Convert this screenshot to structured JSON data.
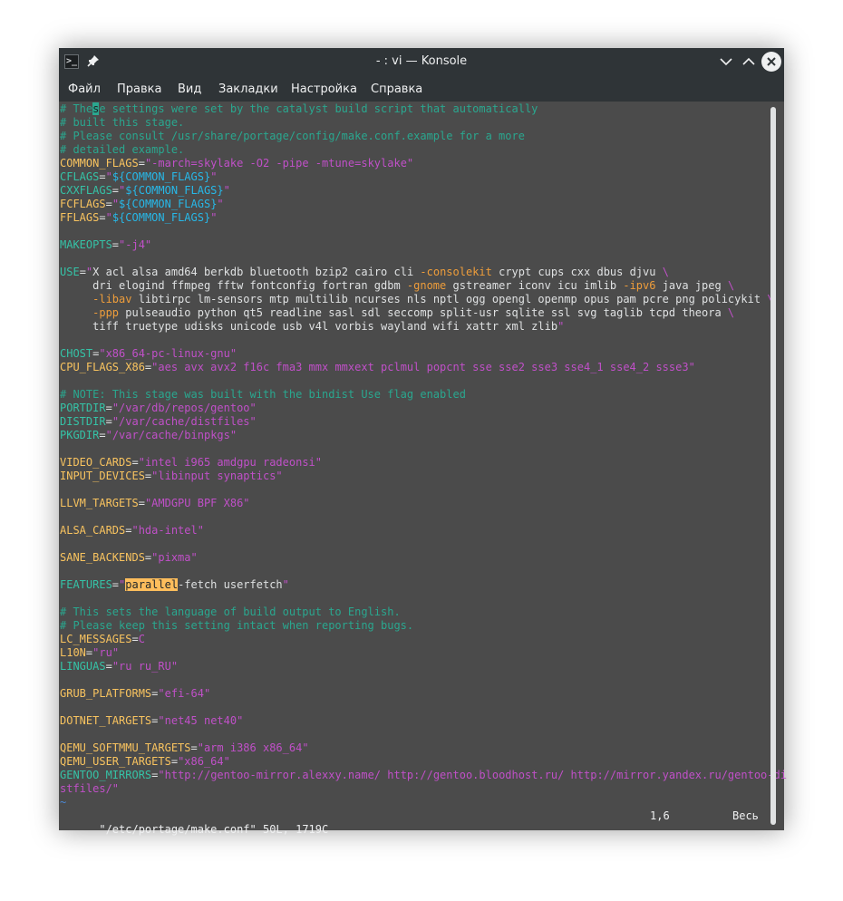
{
  "window": {
    "title": "- : vi — Konsole",
    "app_icon_glyph": ">_"
  },
  "menu": [
    {
      "label": "Файл"
    },
    {
      "label": "Правка"
    },
    {
      "label": "Вид"
    },
    {
      "label": "Закладки"
    },
    {
      "label": "Настройка"
    },
    {
      "label": "Справка"
    }
  ],
  "colors": {
    "titlebar_bg": "#2f3437",
    "terminal_bg": "#4b4b4b",
    "comment": "#2aa78f",
    "variable": "#f8c35f",
    "variable_alt": "#35c2a6",
    "string": "#c050c8",
    "expansion": "#27b8e8",
    "search_highlight": "#fdbd5c"
  },
  "editor": {
    "lines": [
      [
        {
          "t": "# The",
          "c": "comment"
        },
        {
          "t": "s",
          "c": "cursor"
        },
        {
          "t": "e settings were set by the catalyst build script that automatically",
          "c": "comment"
        }
      ],
      [
        {
          "t": "# built this stage.",
          "c": "comment"
        }
      ],
      [
        {
          "t": "# Please consult /usr/share/portage/config/make.conf.example for a more",
          "c": "comment"
        }
      ],
      [
        {
          "t": "# detailed example.",
          "c": "comment"
        }
      ],
      [
        {
          "t": "COMMON_FLAGS",
          "c": "key"
        },
        {
          "t": "=",
          "c": "text"
        },
        {
          "t": "\"-march=skylake -O2 -pipe -mtune=skylake\"",
          "c": "str"
        }
      ],
      [
        {
          "t": "CFLAGS",
          "c": "key2"
        },
        {
          "t": "=",
          "c": "text"
        },
        {
          "t": "\"",
          "c": "str"
        },
        {
          "t": "${COMMON_FLAGS}",
          "c": "var"
        },
        {
          "t": "\"",
          "c": "str"
        }
      ],
      [
        {
          "t": "CXXFLAGS",
          "c": "key2"
        },
        {
          "t": "=",
          "c": "text"
        },
        {
          "t": "\"",
          "c": "str"
        },
        {
          "t": "${COMMON_FLAGS}",
          "c": "var"
        },
        {
          "t": "\"",
          "c": "str"
        }
      ],
      [
        {
          "t": "FCFLAGS",
          "c": "key"
        },
        {
          "t": "=",
          "c": "text"
        },
        {
          "t": "\"",
          "c": "str"
        },
        {
          "t": "${COMMON_FLAGS}",
          "c": "var"
        },
        {
          "t": "\"",
          "c": "str"
        }
      ],
      [
        {
          "t": "FFLAGS",
          "c": "key"
        },
        {
          "t": "=",
          "c": "text"
        },
        {
          "t": "\"",
          "c": "str"
        },
        {
          "t": "${COMMON_FLAGS}",
          "c": "var"
        },
        {
          "t": "\"",
          "c": "str"
        }
      ],
      [],
      [
        {
          "t": "MAKEOPTS",
          "c": "key2"
        },
        {
          "t": "=",
          "c": "text"
        },
        {
          "t": "\"-j4\"",
          "c": "str"
        }
      ],
      [],
      [
        {
          "t": "USE",
          "c": "key2"
        },
        {
          "t": "=",
          "c": "text"
        },
        {
          "t": "\"",
          "c": "str"
        },
        {
          "t": "X acl alsa amd64 berkdb bluetooth bzip2 cairo cli ",
          "c": "text"
        },
        {
          "t": "-consolekit",
          "c": "minus"
        },
        {
          "t": " crypt cups cxx dbus djvu ",
          "c": "text"
        },
        {
          "t": "\\",
          "c": "str"
        }
      ],
      [
        {
          "t": "     dri elogind ffmpeg fftw fontconfig fortran gdbm ",
          "c": "text"
        },
        {
          "t": "-gnome",
          "c": "minus"
        },
        {
          "t": " gstreamer iconv icu imlib ",
          "c": "text"
        },
        {
          "t": "-ipv6",
          "c": "minus"
        },
        {
          "t": " java jpeg ",
          "c": "text"
        },
        {
          "t": "\\",
          "c": "str"
        }
      ],
      [
        {
          "t": "     ",
          "c": "text"
        },
        {
          "t": "-libav",
          "c": "minus"
        },
        {
          "t": " libtirpc lm-sensors mtp multilib ncurses nls nptl ogg opengl openmp opus pam pcre png policykit ",
          "c": "text"
        },
        {
          "t": "\\",
          "c": "str"
        }
      ],
      [
        {
          "t": "     ",
          "c": "text"
        },
        {
          "t": "-ppp",
          "c": "minus"
        },
        {
          "t": " pulseaudio python qt5 readline sasl sdl seccomp split-usr sqlite ssl svg taglib tcpd theora ",
          "c": "text"
        },
        {
          "t": "\\",
          "c": "str"
        }
      ],
      [
        {
          "t": "     tiff truetype udisks unicode usb v4l vorbis wayland wifi xattr xml zlib",
          "c": "text"
        },
        {
          "t": "\"",
          "c": "str"
        }
      ],
      [],
      [
        {
          "t": "CHOST",
          "c": "key2"
        },
        {
          "t": "=",
          "c": "text"
        },
        {
          "t": "\"x86_64-pc-linux-gnu\"",
          "c": "str"
        }
      ],
      [
        {
          "t": "CPU_FLAGS_X86",
          "c": "key"
        },
        {
          "t": "=",
          "c": "text"
        },
        {
          "t": "\"aes avx avx2 f16c fma3 mmx mmxext pclmul popcnt sse sse2 sse3 sse4_1 sse4_2 ssse3\"",
          "c": "str"
        }
      ],
      [],
      [
        {
          "t": "# NOTE: This stage was built with the bindist Use flag enabled",
          "c": "comment"
        }
      ],
      [
        {
          "t": "PORTDIR",
          "c": "key2"
        },
        {
          "t": "=",
          "c": "text"
        },
        {
          "t": "\"/var/db/repos/gentoo\"",
          "c": "str"
        }
      ],
      [
        {
          "t": "DISTDIR",
          "c": "key2"
        },
        {
          "t": "=",
          "c": "text"
        },
        {
          "t": "\"/var/cache/distfiles\"",
          "c": "str"
        }
      ],
      [
        {
          "t": "PKGDIR",
          "c": "key2"
        },
        {
          "t": "=",
          "c": "text"
        },
        {
          "t": "\"/var/cache/binpkgs\"",
          "c": "str"
        }
      ],
      [],
      [
        {
          "t": "VIDEO_CARDS",
          "c": "key"
        },
        {
          "t": "=",
          "c": "text"
        },
        {
          "t": "\"intel i965 amdgpu radeonsi\"",
          "c": "str"
        }
      ],
      [
        {
          "t": "INPUT_DEVICES",
          "c": "key"
        },
        {
          "t": "=",
          "c": "text"
        },
        {
          "t": "\"libinput synaptics\"",
          "c": "str"
        }
      ],
      [],
      [
        {
          "t": "LLVM_TARGETS",
          "c": "key"
        },
        {
          "t": "=",
          "c": "text"
        },
        {
          "t": "\"AMDGPU BPF X86\"",
          "c": "str"
        }
      ],
      [],
      [
        {
          "t": "ALSA_CARDS",
          "c": "key"
        },
        {
          "t": "=",
          "c": "text"
        },
        {
          "t": "\"hda-intel\"",
          "c": "str"
        }
      ],
      [],
      [
        {
          "t": "SANE_BACKENDS",
          "c": "key"
        },
        {
          "t": "=",
          "c": "text"
        },
        {
          "t": "\"pixma\"",
          "c": "str"
        }
      ],
      [],
      [
        {
          "t": "FEATURES",
          "c": "key2"
        },
        {
          "t": "=",
          "c": "text"
        },
        {
          "t": "\"",
          "c": "str"
        },
        {
          "t": "parallel",
          "c": "hl"
        },
        {
          "t": "-fetch userfetch",
          "c": "text"
        },
        {
          "t": "\"",
          "c": "str"
        }
      ],
      [],
      [
        {
          "t": "# This sets the language of build output to English.",
          "c": "comment"
        }
      ],
      [
        {
          "t": "# Please keep this setting intact when reporting bugs.",
          "c": "comment"
        }
      ],
      [
        {
          "t": "LC_MESSAGES",
          "c": "key"
        },
        {
          "t": "=",
          "c": "text"
        },
        {
          "t": "C",
          "c": "str"
        }
      ],
      [
        {
          "t": "L10N",
          "c": "key"
        },
        {
          "t": "=",
          "c": "text"
        },
        {
          "t": "\"ru\"",
          "c": "str"
        }
      ],
      [
        {
          "t": "LINGUAS",
          "c": "key2"
        },
        {
          "t": "=",
          "c": "text"
        },
        {
          "t": "\"ru ru_RU\"",
          "c": "str"
        }
      ],
      [],
      [
        {
          "t": "GRUB_PLATFORMS",
          "c": "key"
        },
        {
          "t": "=",
          "c": "text"
        },
        {
          "t": "\"efi-64\"",
          "c": "str"
        }
      ],
      [],
      [
        {
          "t": "DOTNET_TARGETS",
          "c": "key"
        },
        {
          "t": "=",
          "c": "text"
        },
        {
          "t": "\"net45 net40\"",
          "c": "str"
        }
      ],
      [],
      [
        {
          "t": "QEMU_SOFTMMU_TARGETS",
          "c": "key"
        },
        {
          "t": "=",
          "c": "text"
        },
        {
          "t": "\"arm i386 x86_64\"",
          "c": "str"
        }
      ],
      [
        {
          "t": "QEMU_USER_TARGETS",
          "c": "key"
        },
        {
          "t": "=",
          "c": "text"
        },
        {
          "t": "\"x86_64\"",
          "c": "str"
        }
      ],
      [
        {
          "t": "GENTOO_MIRRORS",
          "c": "key2"
        },
        {
          "t": "=",
          "c": "text"
        },
        {
          "t": "\"http://gentoo-mirror.alexxy.name/ http://gentoo.bloodhost.ru/ http://mirror.yandex.ru/gentoo-di",
          "c": "str"
        }
      ],
      [
        {
          "t": "stfiles/\"",
          "c": "str"
        }
      ],
      [
        {
          "t": "~",
          "c": "tilde"
        }
      ]
    ]
  },
  "status": {
    "file_info": "\"/etc/portage/make.conf\" 50L, 1719C",
    "cursor_pos": "1,6",
    "scroll_pos": "Весь"
  }
}
